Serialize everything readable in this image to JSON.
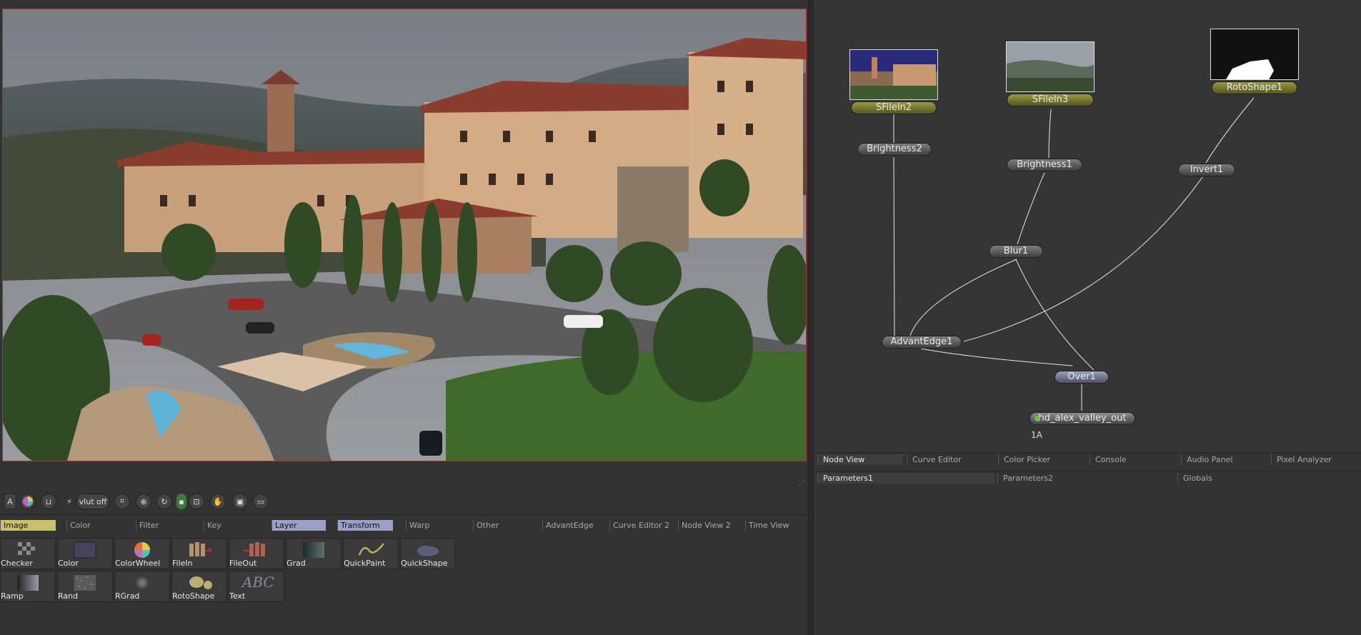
{
  "viewer": {
    "toolbar": {
      "buttons": [
        "A",
        "color-wheel-icon",
        "lock-icon",
        "lightning-icon",
        "vlut off",
        "crop-icon",
        "grid-icon",
        "refresh-icon",
        "roi-icon",
        "frame-icon",
        "hand-icon",
        "snapshot-icon",
        "clip-icon"
      ],
      "vlut_label": "vlut off",
      "a_label": "A"
    }
  },
  "tool_tabs": [
    {
      "label": "Image",
      "state": "selected-yellow"
    },
    {
      "label": "Color",
      "state": ""
    },
    {
      "label": "Filter",
      "state": ""
    },
    {
      "label": "Key",
      "state": ""
    },
    {
      "label": "Layer",
      "state": "selected-blue"
    },
    {
      "label": "Transform",
      "state": "selected-blue"
    },
    {
      "label": "Warp",
      "state": ""
    },
    {
      "label": "Other",
      "state": ""
    },
    {
      "label": "AdvantEdge",
      "state": ""
    },
    {
      "label": "Curve Editor 2",
      "state": ""
    },
    {
      "label": "Node View 2",
      "state": ""
    },
    {
      "label": "Time View",
      "state": ""
    }
  ],
  "tools": [
    {
      "label": "Checker",
      "icon": "checker-icon"
    },
    {
      "label": "Color",
      "icon": "color-icon"
    },
    {
      "label": "ColorWheel",
      "icon": "colorwheel-icon"
    },
    {
      "label": "FileIn",
      "icon": "filein-icon"
    },
    {
      "label": "FileOut",
      "icon": "fileout-icon"
    },
    {
      "label": "Grad",
      "icon": "grad-icon"
    },
    {
      "label": "QuickPaint",
      "icon": "quickpaint-icon"
    },
    {
      "label": "QuickShape",
      "icon": "quickshape-icon"
    },
    {
      "label": "Ramp",
      "icon": "ramp-icon"
    },
    {
      "label": "Rand",
      "icon": "rand-icon"
    },
    {
      "label": "RGrad",
      "icon": "rgrad-icon"
    },
    {
      "label": "RotoShape",
      "icon": "rotoshape-icon"
    },
    {
      "label": "Text",
      "icon": "text-icon",
      "glyph": "ABC"
    }
  ],
  "nodes": {
    "sfilein2": "SFileIn2",
    "sfilein3": "SFileIn3",
    "rotoshape1": "RotoShape1",
    "brightness2": "Brightness2",
    "brightness1": "Brightness1",
    "invert1": "Invert1",
    "blur1": "Blur1",
    "advantedge1": "AdvantEdge1",
    "over1": "Over1",
    "saver": "hd_alex_valley_out",
    "saver_sub": "1A"
  },
  "panel_tabs": [
    "Node View",
    "Curve Editor",
    "Color Picker",
    "Console",
    "Audio Panel",
    "Pixel Analyzer"
  ],
  "param_tabs": [
    "Parameters1",
    "Parameters2",
    "Globals"
  ],
  "colors": {
    "background": "#333333",
    "viewer_border": "#b03030",
    "image_tab": "#c8c36a",
    "layer_tab": "#9aa0c8",
    "loader_node": "#8a8a3a",
    "merge_node": "#7a7f99"
  }
}
